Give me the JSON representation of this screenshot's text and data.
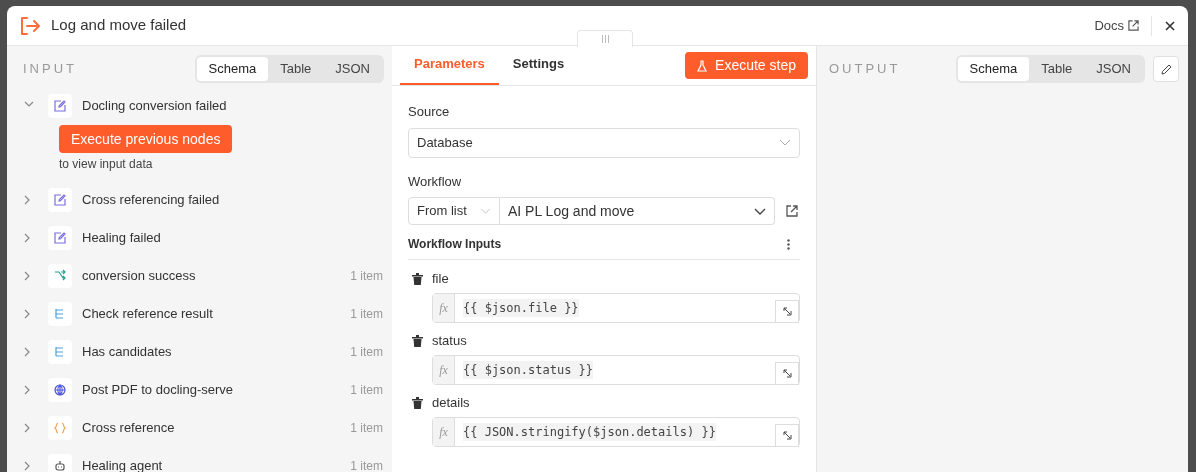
{
  "window": {
    "title": "Log and move failed",
    "docs_link": "Docs"
  },
  "input": {
    "heading": "INPUT",
    "view_tabs": [
      {
        "label": "Schema",
        "selected": true
      },
      {
        "label": "Table",
        "selected": false
      },
      {
        "label": "JSON",
        "selected": false
      }
    ],
    "nodes": [
      {
        "kind": "edit",
        "label": "Docling conversion failed",
        "expanded": true,
        "action_button": "Execute previous nodes",
        "hint": "to view input data"
      },
      {
        "kind": "edit",
        "label": "Cross referencing failed",
        "expanded": false
      },
      {
        "kind": "edit",
        "label": "Healing failed",
        "expanded": false
      },
      {
        "kind": "switch",
        "label": "conversion success",
        "expanded": false,
        "count": "1 item"
      },
      {
        "kind": "branch",
        "label": "Check reference result",
        "expanded": false,
        "count": "1 item"
      },
      {
        "kind": "branch",
        "label": "Has candidates",
        "expanded": false,
        "count": "1 item"
      },
      {
        "kind": "globe",
        "label": "Post PDF to docling-serve",
        "expanded": false,
        "count": "1 item"
      },
      {
        "kind": "code",
        "label": "Cross reference",
        "expanded": false,
        "count": "1 item"
      },
      {
        "kind": "robot",
        "label": "Healing agent",
        "expanded": false,
        "count": "1 item"
      }
    ]
  },
  "parameters": {
    "tabs": [
      {
        "label": "Parameters",
        "selected": true
      },
      {
        "label": "Settings",
        "selected": false
      }
    ],
    "execute_button": "Execute step",
    "source": {
      "label": "Source",
      "value": "Database"
    },
    "workflow": {
      "label": "Workflow",
      "mode": "From list",
      "value": "AI PL Log and move"
    },
    "workflow_inputs": {
      "heading": "Workflow Inputs",
      "fields": [
        {
          "name": "file",
          "prefix": "fx",
          "value": "{{ $json.file }}"
        },
        {
          "name": "status",
          "prefix": "fx",
          "value": "{{ $json.status }}"
        },
        {
          "name": "details",
          "prefix": "fx",
          "value": "{{ JSON.stringify($json.details) }}"
        }
      ]
    }
  },
  "output": {
    "heading": "OUTPUT",
    "view_tabs": [
      {
        "label": "Schema",
        "selected": true
      },
      {
        "label": "Table",
        "selected": false
      },
      {
        "label": "JSON",
        "selected": false
      }
    ]
  }
}
